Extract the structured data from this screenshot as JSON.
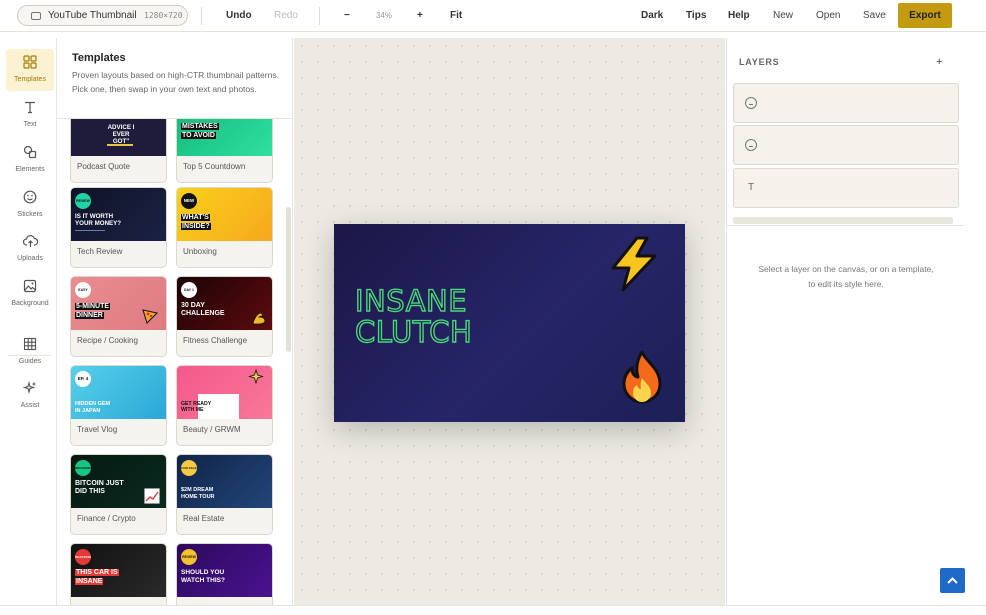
{
  "topbar": {
    "doc_name": "YouTube Thumbnail",
    "doc_size": "1280×720",
    "undo": "Undo",
    "redo": "Redo",
    "zoom_out": "−",
    "zoom": "34%",
    "zoom_in": "+",
    "fit": "Fit",
    "dark": "Dark",
    "tips": "Tips",
    "help": "Help",
    "new": "New",
    "open": "Open",
    "save": "Save",
    "export": "Export"
  },
  "toolrail": {
    "items": [
      {
        "label": "Templates",
        "icon": "grid-icon"
      },
      {
        "label": "Text",
        "icon": "text-icon"
      },
      {
        "label": "Elements",
        "icon": "shapes-icon"
      },
      {
        "label": "Stickers",
        "icon": "smiley-icon"
      },
      {
        "label": "Uploads",
        "icon": "upload-cloud-icon"
      },
      {
        "label": "Background",
        "icon": "image-icon"
      },
      {
        "label": "Guides",
        "icon": "guides-grid-icon"
      },
      {
        "label": "Assist",
        "icon": "sparkle-icon"
      }
    ]
  },
  "templates": {
    "heading": "Templates",
    "description": "Proven layouts based on high-CTR thumbnail patterns. Pick one, then swap in your own text and photos.",
    "cards": [
      {
        "label": "Podcast Quote",
        "thumb_text": [
          "ADVICE I",
          "EVER GOT\""
        ],
        "bg": "#1f1c3b",
        "accent": "#e8c547"
      },
      {
        "label": "Top 5 Countdown",
        "thumb_text": [
          "MISTAKES",
          "TO AVOID"
        ],
        "bg": "#1fc98a",
        "accent": "#0f9d6b"
      },
      {
        "label": "Tech Review",
        "badge": "REVIEW",
        "thumb_text": [
          "IS IT WORTH",
          "YOUR MONEY?"
        ],
        "bg": "#11152d",
        "accent": "#22d3a6"
      },
      {
        "label": "Unboxing",
        "badge": "NEW",
        "thumb_text": [
          "WHAT'S",
          "INSIDE?"
        ],
        "bg": "#f6c51b",
        "accent": "#111111"
      },
      {
        "label": "Recipe / Cooking",
        "badge": "EASY",
        "thumb_text": [
          "5-MINUTE",
          "DINNER"
        ],
        "bg": "#e7898d",
        "accent": "#ffffff"
      },
      {
        "label": "Fitness Challenge",
        "badge": "DAY 1",
        "thumb_text": [
          "30 DAY",
          "CHALLENGE"
        ],
        "bg": "#2a0608",
        "accent": "#f2b829"
      },
      {
        "label": "Travel Vlog",
        "badge": "EP. 4",
        "thumb_text": [
          "HIDDEN GEM",
          "IN JAPAN"
        ],
        "bg": "#3cc3e0",
        "accent": "#ffffff"
      },
      {
        "label": "Beauty / GRWM",
        "thumb_text": [
          "GET READY",
          "WITH ME"
        ],
        "bg": "#f2588f",
        "accent": "#ffffff"
      },
      {
        "label": "Finance / Crypto",
        "badge": "BREAKING",
        "thumb_text": [
          "BITCOIN JUST",
          "DID THIS"
        ],
        "bg": "#06231a",
        "accent": "#16c784"
      },
      {
        "label": "Real Estate",
        "badge": "FOR SALE",
        "thumb_text": [
          "$2M DREAM",
          "HOME TOUR"
        ],
        "bg": "#142b53",
        "accent": "#f6c945"
      },
      {
        "label": "",
        "badge": "REACTION",
        "thumb_text": [
          "THIS CAR IS",
          "INSANE"
        ],
        "bg": "#141414",
        "accent": "#e53935"
      },
      {
        "label": "",
        "badge": "REVIEW",
        "thumb_text": [
          "SHOULD YOU",
          "WATCH THIS?"
        ],
        "bg": "#3a0c72",
        "accent": "#f6c12e"
      }
    ]
  },
  "canvas": {
    "title_lines": [
      "INSANE",
      "CLUTCH"
    ],
    "stickers": [
      "lightning-icon",
      "fire-icon"
    ]
  },
  "layers": {
    "heading": "LAYERS",
    "add": "+",
    "items": [
      {
        "icon": "smiley-icon"
      },
      {
        "icon": "smiley-icon"
      },
      {
        "icon": "text-icon",
        "glyph": "T"
      }
    ],
    "hint": "Select a layer on the canvas, or on a template, to edit its style here."
  }
}
